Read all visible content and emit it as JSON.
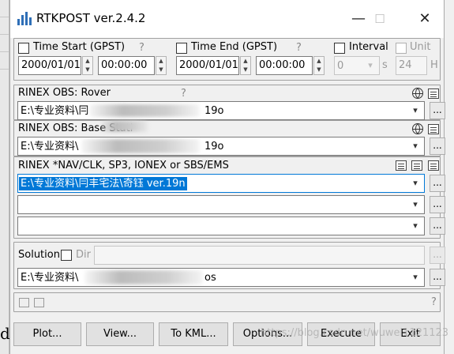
{
  "window": {
    "title": "RTKPOST ver.2.4.2",
    "minimize": "—",
    "maximize": "☐",
    "close": "✕"
  },
  "time_start": {
    "label": "Time Start (GPST)",
    "help": "?",
    "date": "2000/01/01",
    "time": "00:00:00"
  },
  "time_end": {
    "label": "Time End (GPST)",
    "help": "?",
    "date": "2000/01/01",
    "time": "00:00:00"
  },
  "interval": {
    "label": "Interval",
    "value": "0",
    "unit": "s"
  },
  "unit": {
    "label": "Unit",
    "value": "24",
    "unit": "H"
  },
  "rinex_rover": {
    "label": "RINEX OBS: Rover",
    "help": "?",
    "path": "E:\\专业资料\\冃",
    "path_end": "19o"
  },
  "rinex_base": {
    "label": "RINEX OBS: Base Stati",
    "path": "E:\\专业资料\\",
    "path_end": "19o"
  },
  "rinex_nav": {
    "label": "RINEX *NAV/CLK, SP3, IONEX or SBS/EMS",
    "file1": "E:\\专业资料\\冃丰宅法\\奇钰      ver.19n",
    "file2": "",
    "file3": ""
  },
  "solution": {
    "label": "Solution",
    "dir_label": "Dir",
    "dir_value": "",
    "path": "E:\\专业资料\\",
    "path_end": "os"
  },
  "status": {
    "help": "?"
  },
  "buttons": {
    "plot": "Plot...",
    "view": "View...",
    "tokml": "To KML...",
    "options": "Options...",
    "execute": "Execute",
    "exit": "Exit"
  },
  "bg": {
    "letter": "d"
  },
  "watermark": "https://blog.csdn.net/wuwei1121123",
  "icons": {
    "dropdown": "▾",
    "browse": "..."
  },
  "spinner": {
    "up": "▲",
    "down": "▼"
  }
}
